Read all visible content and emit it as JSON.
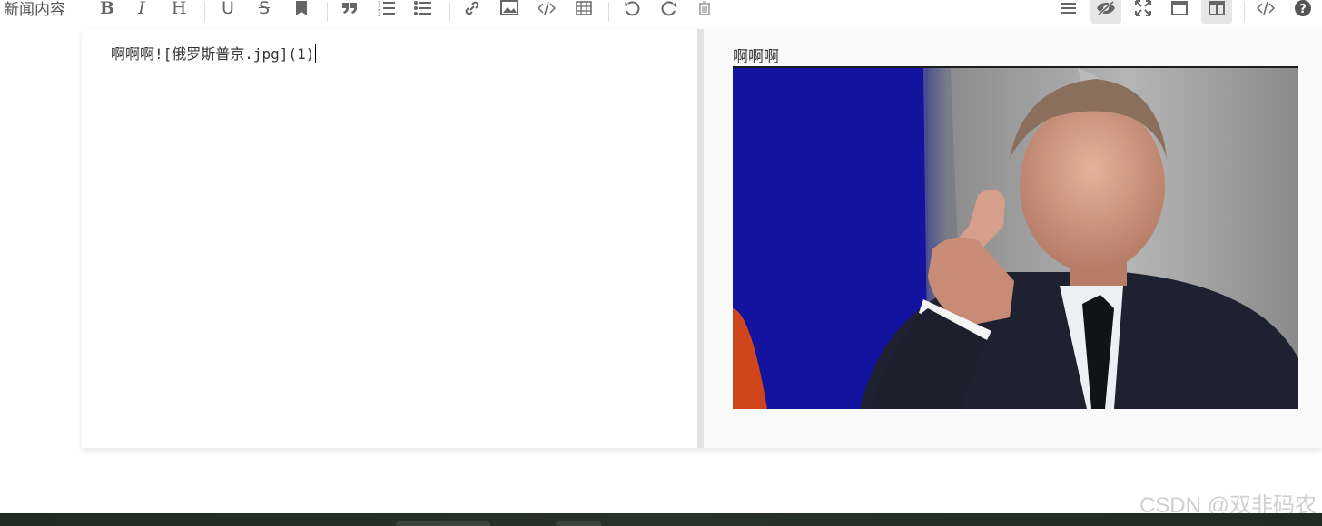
{
  "field": {
    "label": "新闻内容"
  },
  "toolbar": {
    "bold_label": "B",
    "italic_label": "I",
    "heading_label": "H",
    "underline_label": "U",
    "strike_label": "S"
  },
  "editor": {
    "markdown_text": "啊啊啊![俄罗斯普京.jpg](1)"
  },
  "preview": {
    "text": "啊啊啊",
    "image_alt": "俄罗斯普京.jpg"
  },
  "watermark": "CSDN @双非码农",
  "colors": {
    "active_button_bg": "#e6e6e6",
    "toolbar_icon": "#666666",
    "preview_bg": "#fafafa",
    "divider": "#e3e3e3"
  }
}
